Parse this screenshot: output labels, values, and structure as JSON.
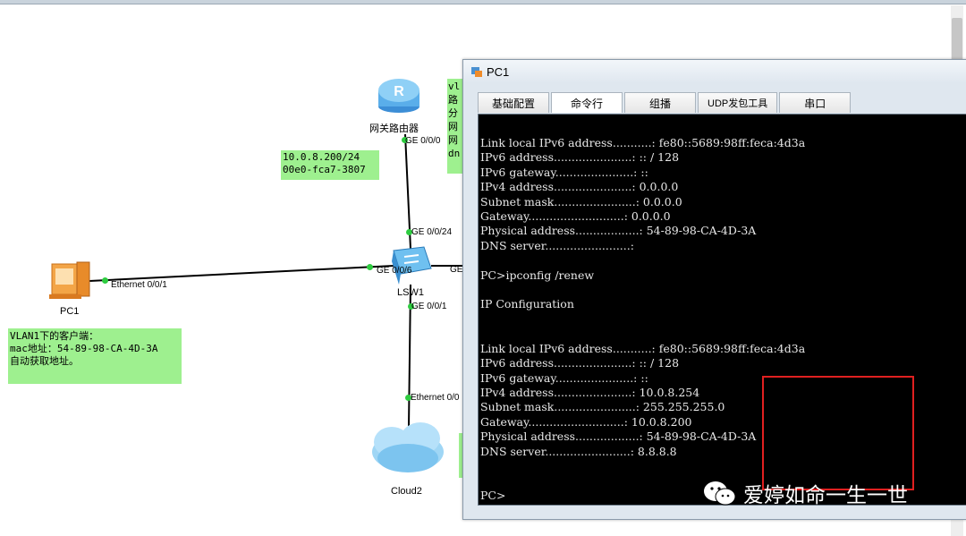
{
  "topology": {
    "router": {
      "label": "网关路由器",
      "port": "GE 0/0/0"
    },
    "switch": {
      "label": "LSW1",
      "port_up": "GE 0/0/24",
      "port_left": "GE 0/0/6",
      "port_right": "GE",
      "port_down": "GE 0/0/1"
    },
    "pc": {
      "label": "PC1",
      "port": "Ethernet 0/0/1"
    },
    "cloud": {
      "label": "Cloud2",
      "port": "Ethernet 0/0"
    },
    "router_note": "10.0.8.200/24\n00e0-fca7-3807",
    "client_note": "VLAN1下的客户端：\nmac地址：54-89-98-CA-4D-3A\n自动获取地址。",
    "partial_note": "vl\n路\n分\n网\n网\ndn"
  },
  "window": {
    "title": "PC1",
    "tabs": [
      "基础配置",
      "命令行",
      "组播",
      "UDP发包工具",
      "串口"
    ],
    "active_tab": "命令行",
    "console_text": "Link local IPv6 address...........: fe80::5689:98ff:feca:4d3a\nIPv6 address......................: :: / 128\nIPv6 gateway......................: ::\nIPv4 address......................: 0.0.0.0\nSubnet mask.......................: 0.0.0.0\nGateway...........................: 0.0.0.0\nPhysical address..................: 54-89-98-CA-4D-3A\nDNS server........................:\n\nPC>ipconfig /renew\n\nIP Configuration\n\n\nLink local IPv6 address...........: fe80::5689:98ff:feca:4d3a\nIPv6 address......................: :: / 128\nIPv6 gateway......................: ::\nIPv4 address......................: 10.0.8.254\nSubnet mask.......................: 255.255.255.0\nGateway...........................: 10.0.8.200\nPhysical address..................: 54-89-98-CA-4D-3A\nDNS server........................: 8.8.8.8\n\n\nPC>"
  },
  "watermark": "爱婷如命一生一世"
}
